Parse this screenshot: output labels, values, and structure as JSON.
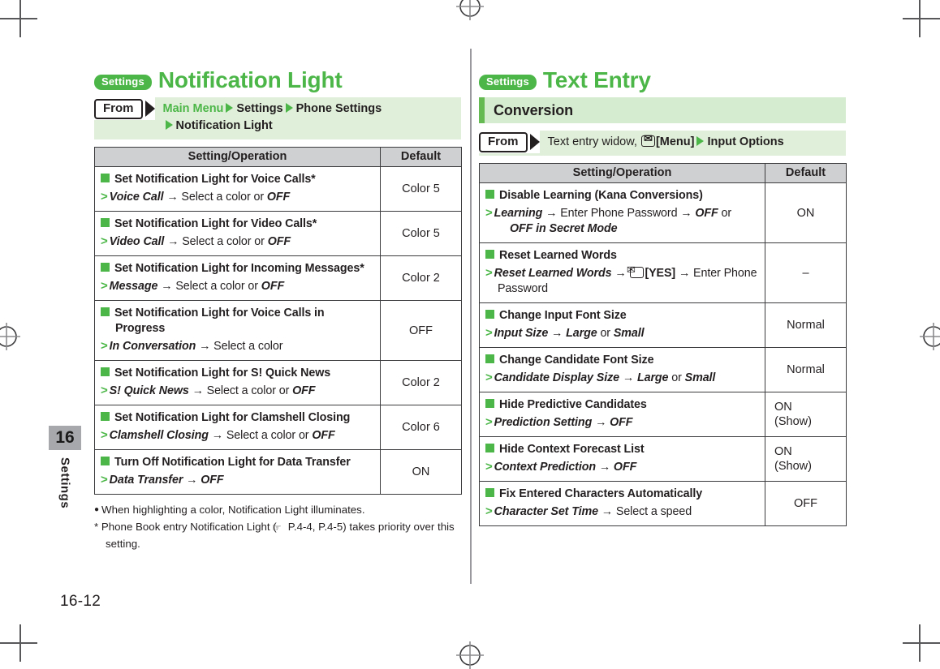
{
  "page": {
    "number": "16-12",
    "chapter_number": "16",
    "chapter_label": "Settings"
  },
  "left_column": {
    "tag": "Settings",
    "title": "Notification Light",
    "from": {
      "label": "From",
      "line1_a": "Main Menu",
      "line1_b": "Settings",
      "line1_c": "Phone Settings",
      "line2": "Notification Light"
    },
    "table": {
      "headers": [
        "Setting/Operation",
        "Default"
      ],
      "rows": [
        {
          "title": "Set Notification Light for Voice Calls*",
          "step_bold": "Voice Call",
          "step_rest": " → Select a color or ",
          "step_tail_bold": "OFF",
          "default": "Color 5"
        },
        {
          "title": "Set Notification Light for Video Calls*",
          "step_bold": "Video Call",
          "step_rest": " → Select a color or ",
          "step_tail_bold": "OFF",
          "default": "Color 5"
        },
        {
          "title": "Set Notification Light for Incoming Messages*",
          "step_bold": "Message",
          "step_rest": " → Select a color or ",
          "step_tail_bold": "OFF",
          "default": "Color 2"
        },
        {
          "title": "Set Notification Light for Voice Calls in Progress",
          "step_bold": "In Conversation",
          "step_rest": " → Select a color",
          "step_tail_bold": "",
          "default": "OFF"
        },
        {
          "title": "Set Notification Light for S! Quick News",
          "step_bold": "S! Quick News",
          "step_rest": " → Select a color or ",
          "step_tail_bold": "OFF",
          "default": "Color 2"
        },
        {
          "title": "Set Notification Light for Clamshell Closing",
          "step_bold": "Clamshell Closing",
          "step_rest": " → Select a color or ",
          "step_tail_bold": "OFF",
          "default": "Color 6"
        },
        {
          "title": "Turn Off Notification Light for Data Transfer",
          "step_bold": "Data Transfer",
          "step_rest": " → ",
          "step_tail_bold": "OFF",
          "default": "ON"
        }
      ]
    },
    "notes": [
      "When highlighting a color, Notification Light illuminates.",
      "Phone Book entry Notification Light (☞P_REF_P.4-4, P.4-5) takes priority over this setting."
    ],
    "note_markers": [
      "●",
      "*"
    ],
    "note2_pre": "Phone Book entry Notification Light (",
    "note2_ref": "P.4-4, P.4-5",
    "note2_post": ") takes priority over this setting."
  },
  "right_column": {
    "tag": "Settings",
    "title": "Text Entry",
    "subsection": "Conversion",
    "from": {
      "label": "From",
      "line1_plain": "Text entry widow,",
      "line1_menu": "[Menu]",
      "line1_tail": "Input Options"
    },
    "table": {
      "headers": [
        "Setting/Operation",
        "Default"
      ],
      "rows": [
        {
          "title": "Disable Learning (Kana Conversions)",
          "step_bold": "Learning",
          "step_rest": " → Enter Phone Password → ",
          "step_tail_bold": "OFF",
          "step_tail2": " or ",
          "step_line2_bold": "OFF in Secret Mode",
          "default": "ON"
        },
        {
          "title": "Reset Learned Words",
          "step_bold": "Reset Learned Words",
          "step_rest": " → ",
          "step_menu": "[YES]",
          "step_after_menu": " → Enter Phone Password",
          "default": "–"
        },
        {
          "title": "Change Input Font Size",
          "step_bold": "Input Size",
          "step_rest": " → ",
          "step_tail_bold": "Large",
          "step_tail2": " or ",
          "step_tail3_bold": "Small",
          "default": "Normal"
        },
        {
          "title": "Change Candidate Font Size",
          "step_bold": "Candidate Display Size",
          "step_rest": " → ",
          "step_tail_bold": "Large",
          "step_tail2": " or ",
          "step_tail3_bold": "Small",
          "default": "Normal"
        },
        {
          "title": "Hide Predictive Candidates",
          "step_bold": "Prediction Setting",
          "step_rest": " → ",
          "step_tail_bold": "OFF",
          "default": "ON",
          "default2": "(Show)"
        },
        {
          "title": "Hide Context Forecast List",
          "step_bold": "Context Prediction",
          "step_rest": " → ",
          "step_tail_bold": "OFF",
          "default": "ON",
          "default2": "(Show)"
        },
        {
          "title": "Fix Entered Characters Automatically",
          "step_bold": "Character Set Time",
          "step_rest": " → Select a speed",
          "step_tail_bold": "",
          "default": "OFF"
        }
      ]
    }
  },
  "colors": {
    "brand_green": "#4cb748",
    "band_green": "#e0efd9",
    "subsection_green": "#d6ecd0",
    "accent_bar": "#65bb52",
    "table_header": "#cfd0d2",
    "tab_gray": "#a6a8ab",
    "text": "#231f20"
  }
}
